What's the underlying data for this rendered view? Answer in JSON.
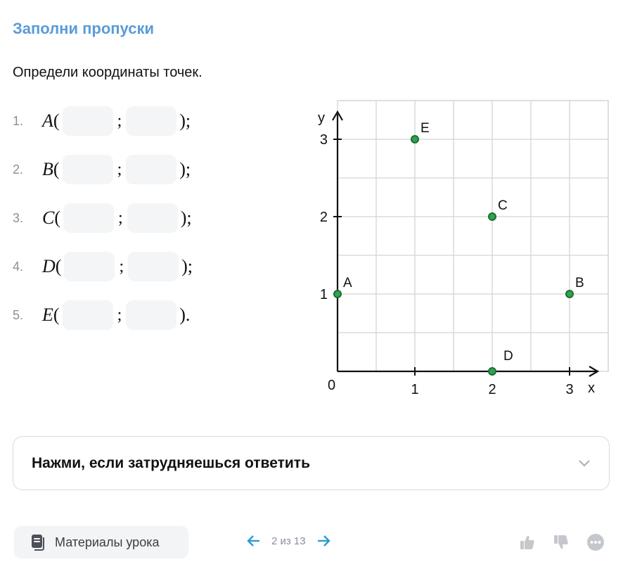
{
  "task": {
    "type_title": "Заполни пропуски",
    "question": "Определи координаты точек."
  },
  "items": [
    {
      "num": "1.",
      "letter": "A",
      "open": "(",
      "sep": ";",
      "close": ");"
    },
    {
      "num": "2.",
      "letter": "B",
      "open": "(",
      "sep": ";",
      "close": ");"
    },
    {
      "num": "3.",
      "letter": "C",
      "open": "(",
      "sep": ";",
      "close": ");"
    },
    {
      "num": "4.",
      "letter": "D",
      "open": "(",
      "sep": ";",
      "close": ");"
    },
    {
      "num": "5.",
      "letter": "E",
      "open": "(",
      "sep": ";",
      "close": ")."
    }
  ],
  "graph": {
    "x_axis_label": "x",
    "y_axis_label": "y",
    "origin_label": "0",
    "x_ticks": [
      "1",
      "2",
      "3"
    ],
    "y_ticks": [
      "1",
      "2",
      "3"
    ],
    "points": [
      {
        "name": "A",
        "x": 0,
        "y": 1
      },
      {
        "name": "B",
        "x": 3,
        "y": 1
      },
      {
        "name": "C",
        "x": 2,
        "y": 2
      },
      {
        "name": "D",
        "x": 2,
        "y": 0
      },
      {
        "name": "E",
        "x": 1,
        "y": 3
      }
    ],
    "point_color": "#2ea44f"
  },
  "hint": {
    "label": "Нажми, если затрудняешься ответить"
  },
  "footer": {
    "materials_label": "Материалы урока",
    "pager_text": "2 из 13"
  },
  "icons": {
    "materials": "book-icon",
    "prev": "arrow-left-icon",
    "next": "arrow-right-icon",
    "like": "thumbs-up-icon",
    "dislike": "thumbs-down-icon",
    "more": "more-icon",
    "expand": "chevron-down-icon"
  },
  "colors": {
    "accent": "#5b9bd8",
    "nav_arrow": "#2a9bd4"
  }
}
